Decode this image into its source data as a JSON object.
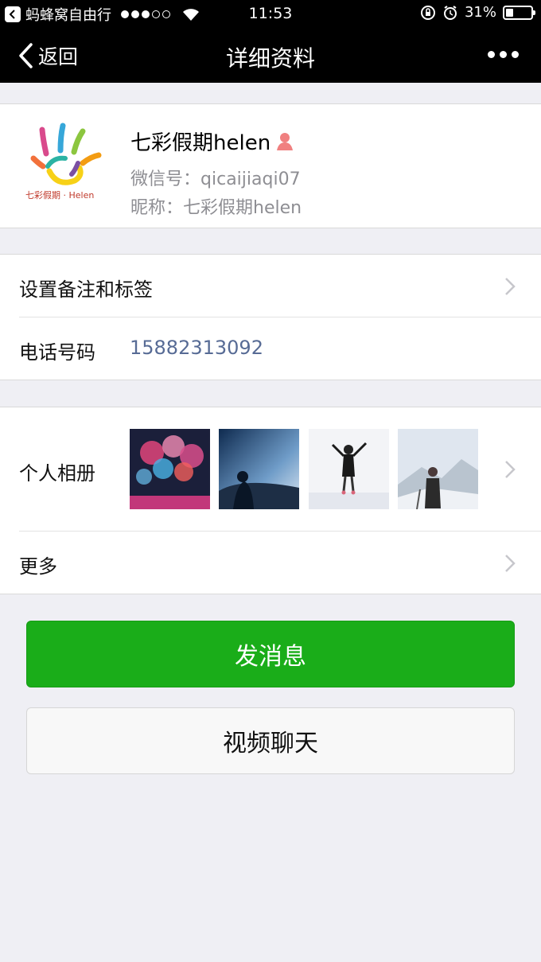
{
  "status_bar": {
    "carrier": "蚂蜂窝自由行",
    "time": "11:53",
    "battery": "31%",
    "battery_level": 0.31,
    "signal_bars_filled": 3,
    "signal_bars_total": 5
  },
  "nav": {
    "back_label": "返回",
    "title": "详细资料"
  },
  "profile": {
    "name": "七彩假期helen",
    "wechat_id_label": "微信号：",
    "wechat_id": "qicaijiaqi07",
    "nickname_label": "昵称：",
    "nickname": "七彩假期helen",
    "avatar_text": "七彩假期 · Helen",
    "gender": "female"
  },
  "rows": {
    "remark": {
      "label": "设置备注和标签"
    },
    "phone": {
      "label": "电话号码",
      "value": "15882313092"
    },
    "album": {
      "label": "个人相册"
    },
    "more": {
      "label": "更多"
    }
  },
  "actions": {
    "message": "发消息",
    "video_call": "视频聊天"
  },
  "colors": {
    "accent_green": "#1aad19",
    "link_blue": "#576b95",
    "bar_black": "#000000",
    "background": "#efeff4"
  }
}
